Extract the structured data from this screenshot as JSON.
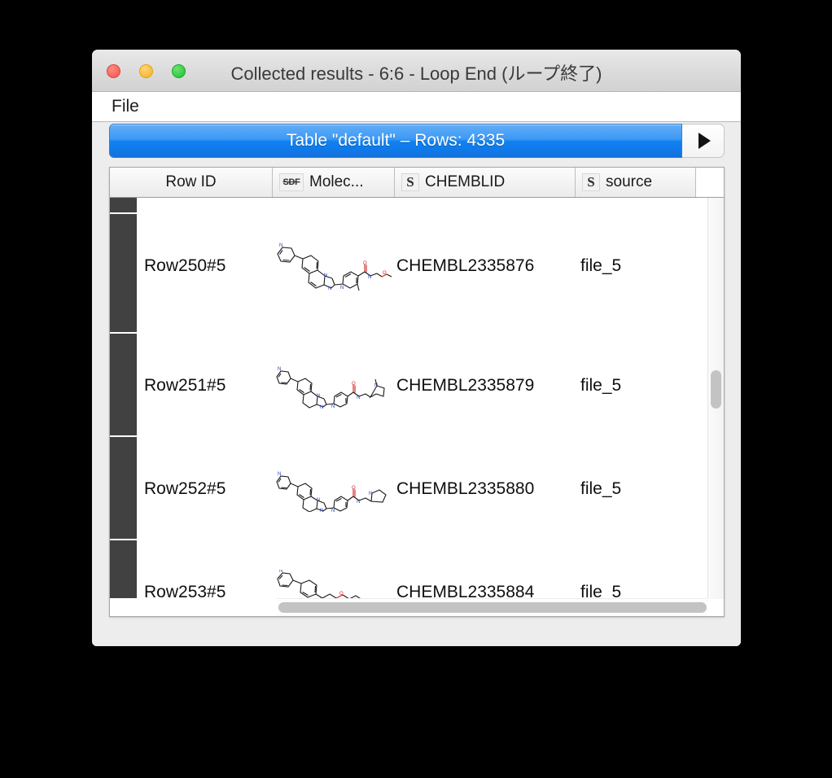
{
  "window": {
    "title": "Collected results - 6:6 - Loop End (ループ終了)",
    "traffic_lights": {
      "close": "close-button",
      "minimize": "minimize-button",
      "maximize": "maximize-button"
    },
    "colors": {
      "close": "#f2544c",
      "minimize": "#f5b322",
      "maximize": "#1dbf35",
      "accent_blue": "#0f81f2",
      "gutter": "#414141",
      "scroll_thumb": "#c3c3c3"
    }
  },
  "menubar": {
    "items": [
      {
        "label": "File"
      }
    ]
  },
  "table_bar": {
    "label": "Table \"default\" – Rows: 4335",
    "next_button_icon": "play-triangle-icon"
  },
  "table": {
    "columns": [
      {
        "key": "rowid",
        "label": "Row ID",
        "icon": null
      },
      {
        "key": "mol",
        "label": "Molec...",
        "icon": "SDF"
      },
      {
        "key": "chembl",
        "label": "CHEMBLID",
        "icon": "S"
      },
      {
        "key": "source",
        "label": "source",
        "icon": "S"
      }
    ],
    "rows": [
      {
        "rowid": "Row250#5",
        "chembl": "CHEMBL2335876",
        "source": "file_5",
        "molecule": "molecule-structure-1"
      },
      {
        "rowid": "Row251#5",
        "chembl": "CHEMBL2335879",
        "source": "file_5",
        "molecule": "molecule-structure-2"
      },
      {
        "rowid": "Row252#5",
        "chembl": "CHEMBL2335880",
        "source": "file_5",
        "molecule": "molecule-structure-3"
      },
      {
        "rowid": "Row253#5",
        "chembl": "CHEMBL2335884",
        "source": "file_5",
        "molecule": "molecule-structure-4"
      }
    ]
  },
  "scrollbars": {
    "vertical": "vertical-scrollbar",
    "horizontal": "horizontal-scrollbar"
  }
}
